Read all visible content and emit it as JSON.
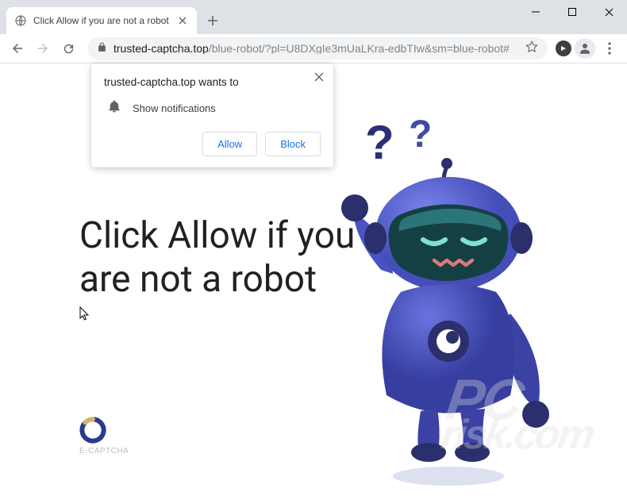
{
  "window": {
    "tab_title": "Click Allow if you are not a robot"
  },
  "url": {
    "host": "trusted-captcha.top",
    "path": "/blue-robot/?pl=U8DXgIe3mUaLKra-edbTIw&sm=blue-robot#"
  },
  "notification": {
    "title": "trusted-captcha.top wants to",
    "permission": "Show notifications",
    "allow": "Allow",
    "block": "Block"
  },
  "page": {
    "headline": "Click Allow if you are not a robot",
    "ecaptcha": "E-CAPTCHA"
  },
  "watermark": {
    "line1": "PC",
    "line2": "risk.com"
  }
}
